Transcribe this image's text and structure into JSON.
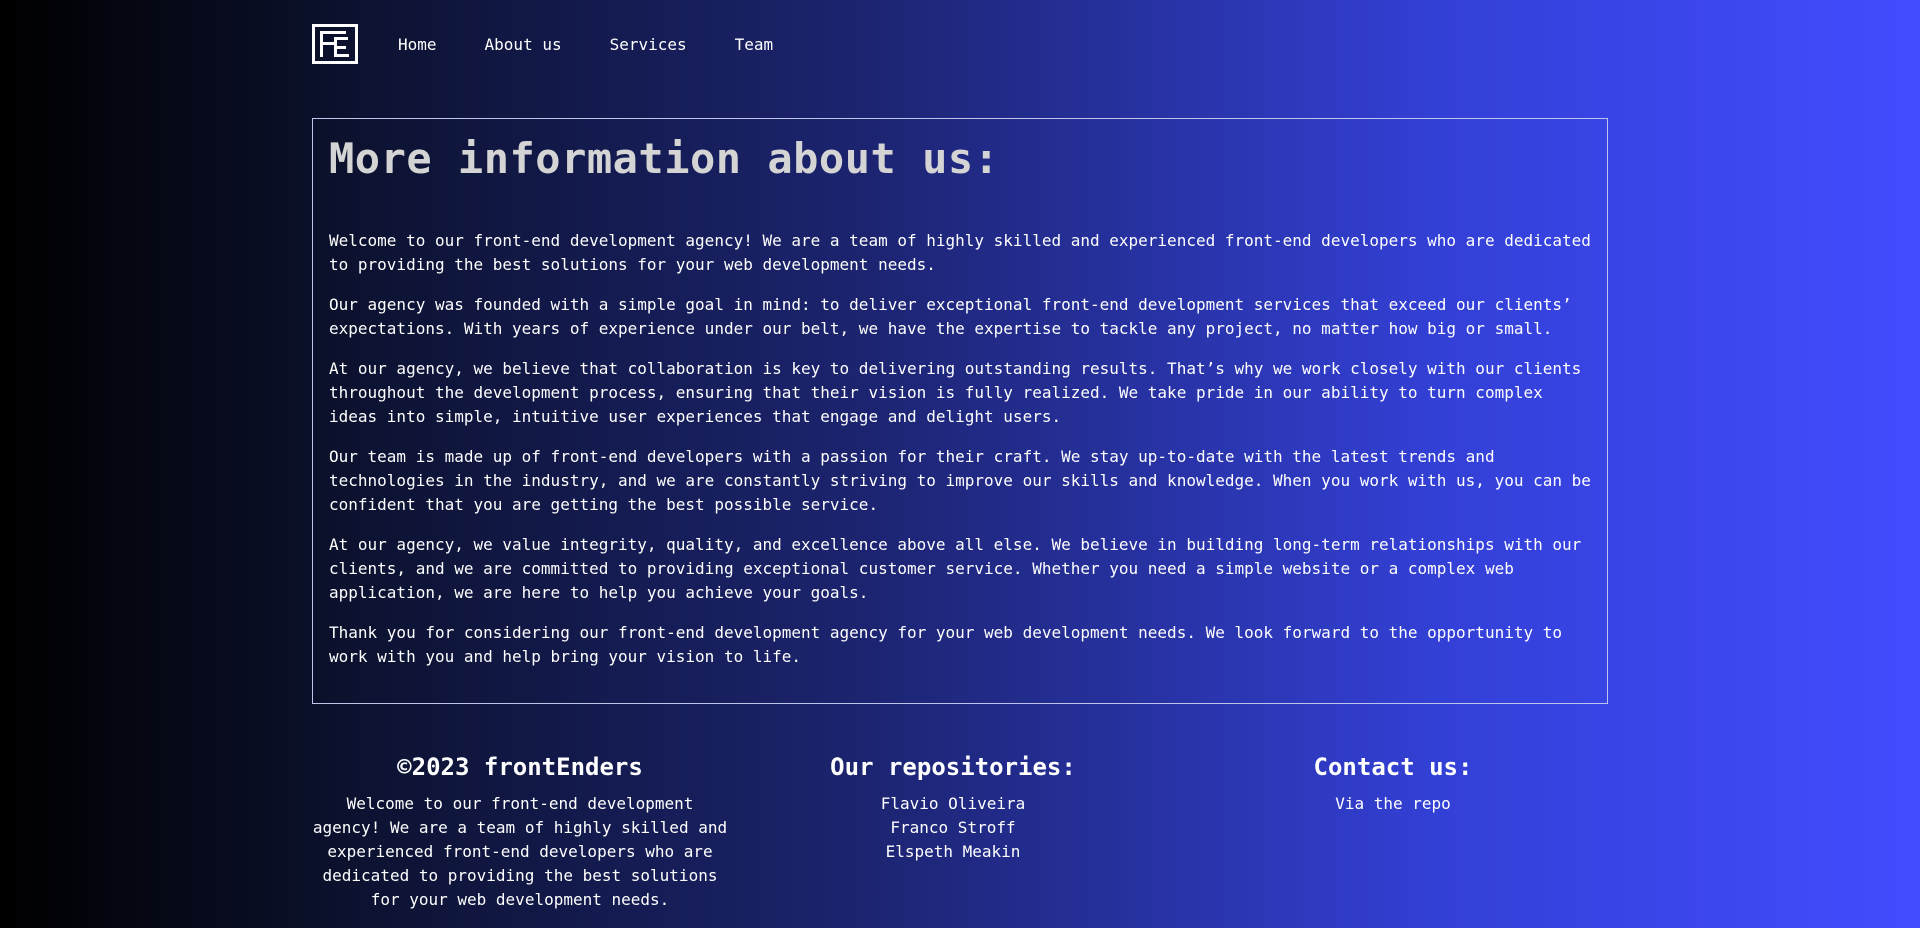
{
  "nav": {
    "links": [
      "Home",
      "About us",
      "Services",
      "Team"
    ]
  },
  "about": {
    "title": "More information about us:",
    "paragraphs": [
      "Welcome to our front-end development agency! We are a team of highly skilled and experienced front-end developers who are dedicated to providing the best solutions for your web development needs.",
      "Our agency was founded with a simple goal in mind: to deliver exceptional front-end development services that exceed our clients’ expectations. With years of experience under our belt, we have the expertise to tackle any project, no matter how big or small.",
      "At our agency, we believe that collaboration is key to delivering outstanding results. That’s why we work closely with our clients throughout the development process, ensuring that their vision is fully realized. We take pride in our ability to turn complex ideas into simple, intuitive user experiences that engage and delight users.",
      "Our team is made up of front-end developers with a passion for their craft. We stay up-to-date with the latest trends and technologies in the industry, and we are constantly striving to improve our skills and knowledge. When you work with us, you can be confident that you are getting the best possible service.",
      "At our agency, we value integrity, quality, and excellence above all else. We believe in building long-term relationships with our clients, and we are committed to providing exceptional customer service. Whether you need a simple website or a complex web application, we are here to help you achieve your goals.",
      "Thank you for considering our front-end development agency for your web development needs. We look forward to the opportunity to work with you and help bring your vision to life."
    ]
  },
  "footer": {
    "company": {
      "title": "©2023 frontEnders",
      "text": "Welcome to our front-end development agency! We are a team of highly skilled and experienced front-end developers who are dedicated to providing the best solutions for your web development needs."
    },
    "repos": {
      "title": "Our repositories:",
      "links": [
        "Flavio Oliveira",
        "Franco Stroff",
        "Elspeth Meakin"
      ]
    },
    "contact": {
      "title": "Contact us:",
      "link": "Via the repo"
    }
  }
}
